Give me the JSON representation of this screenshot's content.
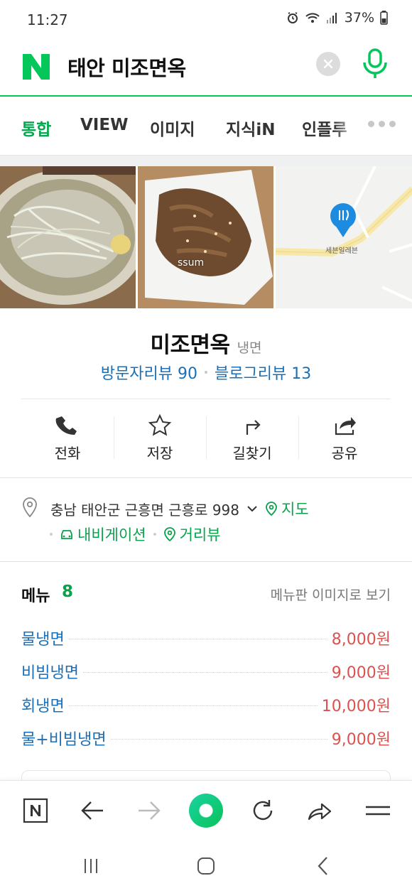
{
  "status_bar": {
    "time": "11:27",
    "battery": "37%",
    "icons": [
      "alarm-icon",
      "wifi-icon",
      "signal-icon",
      "battery-icon"
    ]
  },
  "search": {
    "query": "태안 미조면옥",
    "logo": "N",
    "clear_icon": "close-icon",
    "voice_icon": "microphone-icon"
  },
  "tabs": {
    "items": [
      "통합",
      "VIEW",
      "이미지",
      "지식iN",
      "인플루"
    ],
    "active": "통합",
    "more_icon": "more-dots-icon"
  },
  "photos": {
    "watermark": "ssum",
    "map_label": "세븐일레븐"
  },
  "place": {
    "name": "미조면옥",
    "category": "냉면",
    "visitor_reviews": "방문자리뷰 90",
    "blog_reviews": "블로그리뷰 13"
  },
  "actions": [
    {
      "label": "전화",
      "icon": "phone-icon"
    },
    {
      "label": "저장",
      "icon": "star-icon"
    },
    {
      "label": "길찾기",
      "icon": "directions-icon"
    },
    {
      "label": "공유",
      "icon": "share-icon"
    }
  ],
  "address": {
    "text": "충남 태안군 근흥면 근흥로 998",
    "map_link": "지도",
    "navigation_link": "내비게이션",
    "street_view_link": "거리뷰"
  },
  "menu": {
    "title": "메뉴",
    "count": "8",
    "view_image_link": "메뉴판 이미지로 보기",
    "items": [
      {
        "name": "물냉면",
        "price": "8,000원"
      },
      {
        "name": "비빔냉면",
        "price": "9,000원"
      },
      {
        "name": "회냉면",
        "price": "10,000원"
      },
      {
        "name": "물+비빔냉면",
        "price": "9,000원"
      }
    ]
  },
  "toolbar": {
    "items": [
      "naver-home-icon",
      "back-arrow-icon",
      "forward-arrow-icon",
      "green-dot-icon",
      "refresh-icon",
      "share-arrow-icon",
      "menu-icon"
    ]
  },
  "colors": {
    "brand_green": "#03c75a",
    "link_blue": "#1b6fb6",
    "price_red": "#d9534f"
  }
}
